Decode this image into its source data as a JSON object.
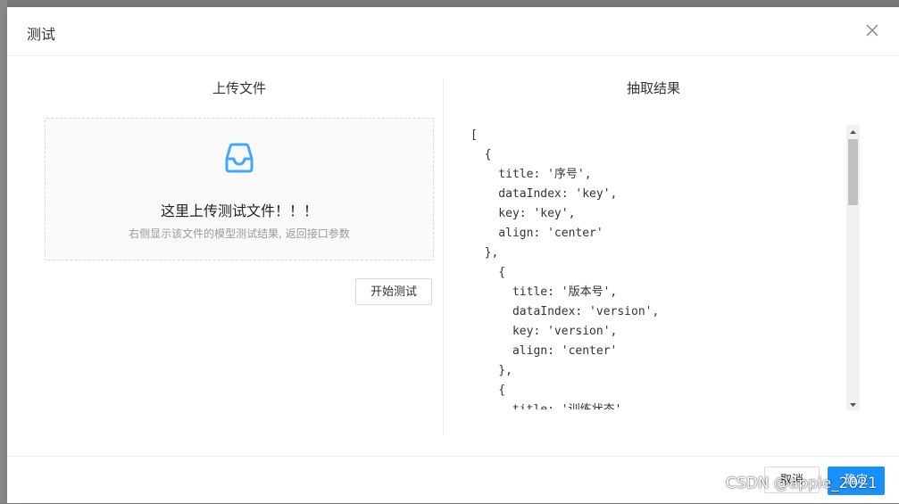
{
  "modal": {
    "title": "测试",
    "close_icon": "close-icon"
  },
  "left": {
    "title": "上传文件",
    "upload": {
      "icon": "inbox-icon",
      "text": "这里上传测试文件！！！",
      "hint": "右侧显示该文件的模型测试结果, 返回接口参数"
    },
    "start_button": "开始测试"
  },
  "right": {
    "title": "抽取结果",
    "code_lines": [
      "[",
      "  {",
      "    title: '序号',",
      "    dataIndex: 'key',",
      "    key: 'key',",
      "    align: 'center'",
      "  },",
      "    {",
      "      title: '版本号',",
      "      dataIndex: 'version',",
      "      key: 'version',",
      "      align: 'center'",
      "    },",
      "    {",
      "      title: '训练状态',"
    ]
  },
  "footer": {
    "cancel": "取消",
    "ok": "确定"
  },
  "watermark": "CSDN @apple_2021",
  "colors": {
    "primary": "#1890ff",
    "icon": "#40a9ff"
  }
}
